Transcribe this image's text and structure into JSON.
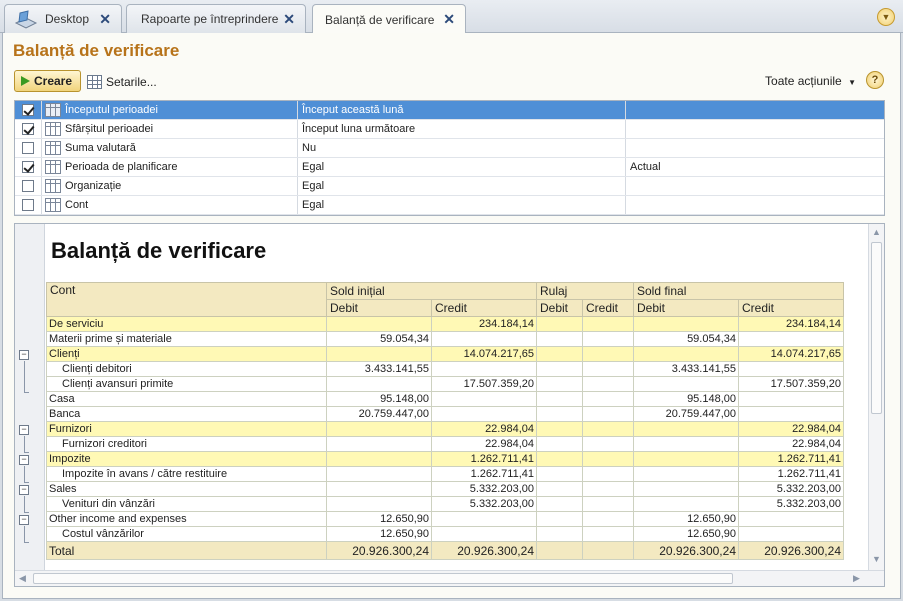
{
  "tabs": [
    {
      "label": "Desktop"
    },
    {
      "label": "Rapoarte pe întreprindere"
    },
    {
      "label": "Balanță de verificare"
    }
  ],
  "page": {
    "title": "Balanță de verificare"
  },
  "toolbar": {
    "create_label": "Creare",
    "settings_label": "Setarile...",
    "all_actions_label": "Toate acțiunile",
    "help_label": "?"
  },
  "filters": [
    {
      "checked": true,
      "name": "Începutul perioadei",
      "comparison": "Început această lună",
      "value": ""
    },
    {
      "checked": true,
      "name": "Sfârșitul perioadei",
      "comparison": "Început luna următoare",
      "value": ""
    },
    {
      "checked": false,
      "name": "Suma valutară",
      "comparison": "Nu",
      "value": ""
    },
    {
      "checked": true,
      "name": "Perioada de planificare",
      "comparison": "Egal",
      "value": "Actual"
    },
    {
      "checked": false,
      "name": "Organizație",
      "comparison": "Egal",
      "value": ""
    },
    {
      "checked": false,
      "name": "Cont",
      "comparison": "Egal",
      "value": ""
    }
  ],
  "report": {
    "title": "Balanță de verificare",
    "headers": {
      "account": "Cont",
      "opening": "Sold inițial",
      "turnover": "Rulaj",
      "closing": "Sold final",
      "debit": "Debit",
      "credit": "Credit"
    },
    "rows": [
      {
        "name": "De serviciu",
        "group": true,
        "indent": false,
        "od": "",
        "oc": "234.184,14",
        "td": "",
        "tc": "",
        "cd": "",
        "cc": "234.184,14"
      },
      {
        "name": "Materii prime și materiale",
        "group": false,
        "indent": false,
        "od": "59.054,34",
        "oc": "",
        "td": "",
        "tc": "",
        "cd": "59.054,34",
        "cc": ""
      },
      {
        "name": "Clienți",
        "group": true,
        "indent": false,
        "od": "",
        "oc": "14.074.217,65",
        "td": "",
        "tc": "",
        "cd": "",
        "cc": "14.074.217,65"
      },
      {
        "name": "Clienți debitori",
        "group": false,
        "indent": true,
        "od": "3.433.141,55",
        "oc": "",
        "td": "",
        "tc": "",
        "cd": "3.433.141,55",
        "cc": ""
      },
      {
        "name": "Clienți avansuri primite",
        "group": false,
        "indent": true,
        "od": "",
        "oc": "17.507.359,20",
        "td": "",
        "tc": "",
        "cd": "",
        "cc": "17.507.359,20"
      },
      {
        "name": "Casa",
        "group": false,
        "indent": false,
        "od": "95.148,00",
        "oc": "",
        "td": "",
        "tc": "",
        "cd": "95.148,00",
        "cc": ""
      },
      {
        "name": "Banca",
        "group": false,
        "indent": false,
        "od": "20.759.447,00",
        "oc": "",
        "td": "",
        "tc": "",
        "cd": "20.759.447,00",
        "cc": ""
      },
      {
        "name": "Furnizori",
        "group": true,
        "indent": false,
        "od": "",
        "oc": "22.984,04",
        "td": "",
        "tc": "",
        "cd": "",
        "cc": "22.984,04"
      },
      {
        "name": "Furnizori creditori",
        "group": false,
        "indent": true,
        "od": "",
        "oc": "22.984,04",
        "td": "",
        "tc": "",
        "cd": "",
        "cc": "22.984,04"
      },
      {
        "name": "Impozite",
        "group": true,
        "indent": false,
        "od": "",
        "oc": "1.262.711,41",
        "td": "",
        "tc": "",
        "cd": "",
        "cc": "1.262.711,41"
      },
      {
        "name": "Impozite în avans / către restituire",
        "group": false,
        "indent": true,
        "od": "",
        "oc": "1.262.711,41",
        "td": "",
        "tc": "",
        "cd": "",
        "cc": "1.262.711,41"
      },
      {
        "name": "Sales",
        "group": false,
        "indent": false,
        "od": "",
        "oc": "5.332.203,00",
        "td": "",
        "tc": "",
        "cd": "",
        "cc": "5.332.203,00"
      },
      {
        "name": "Venituri din vânzări",
        "group": false,
        "indent": true,
        "od": "",
        "oc": "5.332.203,00",
        "td": "",
        "tc": "",
        "cd": "",
        "cc": "5.332.203,00"
      },
      {
        "name": "Other income and expenses",
        "group": false,
        "indent": false,
        "od": "12.650,90",
        "oc": "",
        "td": "",
        "tc": "",
        "cd": "12.650,90",
        "cc": ""
      },
      {
        "name": "Costul vânzărilor",
        "group": false,
        "indent": true,
        "od": "12.650,90",
        "oc": "",
        "td": "",
        "tc": "",
        "cd": "12.650,90",
        "cc": ""
      }
    ],
    "total": {
      "name": "Total",
      "od": "20.926.300,24",
      "oc": "20.926.300,24",
      "td": "",
      "tc": "",
      "cd": "20.926.300,24",
      "cc": "20.926.300,24"
    }
  }
}
